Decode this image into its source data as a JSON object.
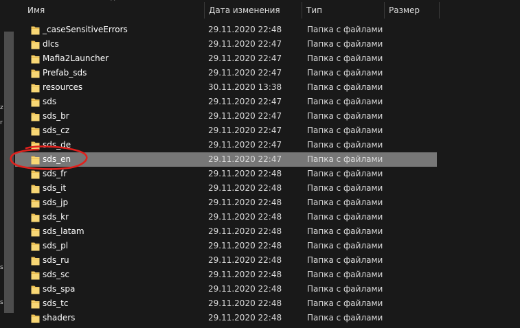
{
  "header": {
    "columns": [
      {
        "label": "Имя"
      },
      {
        "label": "Дата изменения"
      },
      {
        "label": "Тип"
      },
      {
        "label": "Размер"
      }
    ],
    "sort_arrow": "^"
  },
  "files": [
    {
      "name": "_caseSensitiveErrors",
      "date": "29.11.2020 22:48",
      "type": "Папка с файлами"
    },
    {
      "name": "dlcs",
      "date": "29.11.2020 22:47",
      "type": "Папка с файлами"
    },
    {
      "name": "Mafia2Launcher",
      "date": "29.11.2020 22:47",
      "type": "Папка с файлами"
    },
    {
      "name": "Prefab_sds",
      "date": "29.11.2020 22:47",
      "type": "Папка с файлами"
    },
    {
      "name": "resources",
      "date": "30.11.2020 13:38",
      "type": "Папка с файлами"
    },
    {
      "name": "sds",
      "date": "29.11.2020 22:47",
      "type": "Папка с файлами"
    },
    {
      "name": "sds_br",
      "date": "29.11.2020 22:47",
      "type": "Папка с файлами"
    },
    {
      "name": "sds_cz",
      "date": "29.11.2020 22:47",
      "type": "Папка с файлами"
    },
    {
      "name": "sds_de",
      "date": "29.11.2020 22:47",
      "type": "Папка с файлами"
    },
    {
      "name": "sds_en",
      "date": "29.11.2020 22:47",
      "type": "Папка с файлами"
    },
    {
      "name": "sds_fr",
      "date": "29.11.2020 22:48",
      "type": "Папка с файлами"
    },
    {
      "name": "sds_it",
      "date": "29.11.2020 22:48",
      "type": "Папка с файлами"
    },
    {
      "name": "sds_jp",
      "date": "29.11.2020 22:48",
      "type": "Папка с файлами"
    },
    {
      "name": "sds_kr",
      "date": "29.11.2020 22:48",
      "type": "Папка с файлами"
    },
    {
      "name": "sds_latam",
      "date": "29.11.2020 22:48",
      "type": "Папка с файлами"
    },
    {
      "name": "sds_pl",
      "date": "29.11.2020 22:48",
      "type": "Папка с файлами"
    },
    {
      "name": "sds_ru",
      "date": "29.11.2020 22:48",
      "type": "Папка с файлами"
    },
    {
      "name": "sds_sc",
      "date": "29.11.2020 22:48",
      "type": "Папка с файлами"
    },
    {
      "name": "sds_spa",
      "date": "29.11.2020 22:48",
      "type": "Папка с файлами"
    },
    {
      "name": "sds_tc",
      "date": "29.11.2020 22:48",
      "type": "Папка с файлами"
    },
    {
      "name": "shaders",
      "date": "29.11.2020 22:48",
      "type": "Папка с файлами"
    }
  ],
  "selected_index": 9,
  "left_pane_glyphs": [
    "z",
    "r",
    "s",
    "s"
  ],
  "icons": {
    "folder": "folder-icon"
  },
  "colors": {
    "background": "#191919",
    "selected_row": "#777777",
    "folder_fill": "#F8D775",
    "folder_tab": "#E8B94A",
    "annotation_red": "#E0211D",
    "header_text": "#DEDEDE"
  }
}
